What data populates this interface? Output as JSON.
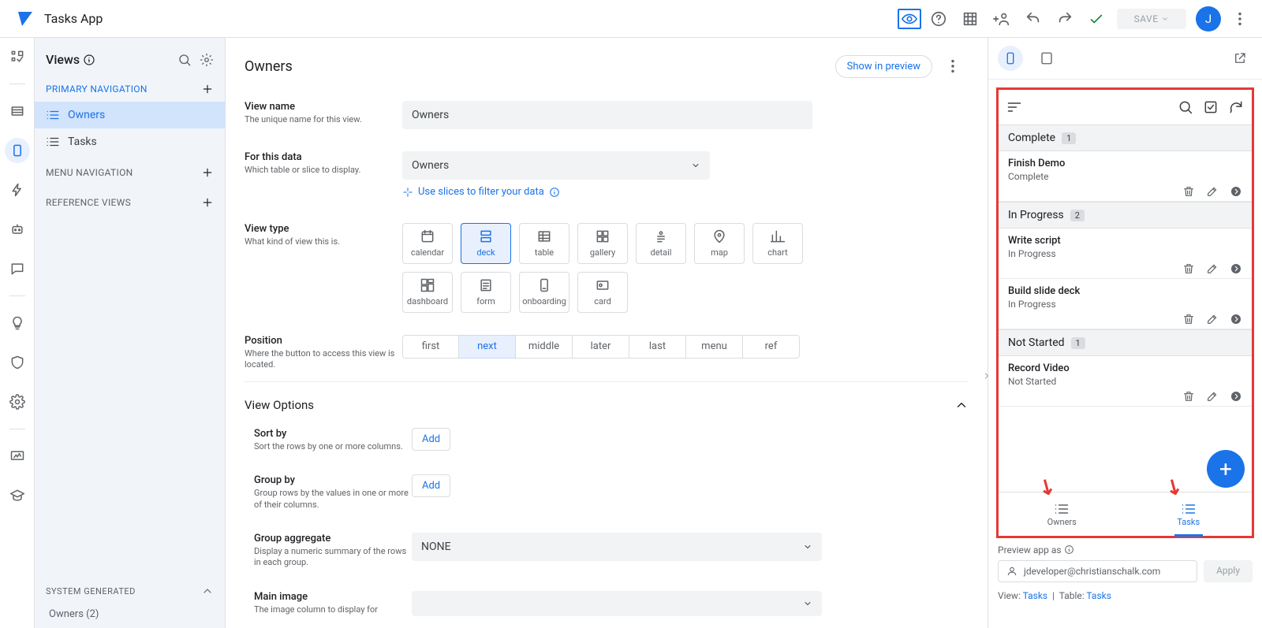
{
  "header": {
    "app_name": "Tasks App",
    "save_label": "SAVE",
    "avatar_initial": "J"
  },
  "views_panel": {
    "title": "Views",
    "sections": {
      "primary": "PRIMARY NAVIGATION",
      "menu": "MENU NAVIGATION",
      "ref": "REFERENCE VIEWS",
      "sysgen": "SYSTEM GENERATED",
      "sysgen_item": "Owners (2)"
    },
    "items": [
      "Owners",
      "Tasks"
    ]
  },
  "editor": {
    "title": "Owners",
    "show_in_preview": "Show in preview",
    "view_name": {
      "label": "View name",
      "help": "The unique name for this view.",
      "value": "Owners"
    },
    "for_data": {
      "label": "For this data",
      "help": "Which table or slice to display.",
      "value": "Owners",
      "hint": "Use slices to filter your data"
    },
    "view_type": {
      "label": "View type",
      "help": "What kind of view this is.",
      "options": [
        "calendar",
        "deck",
        "table",
        "gallery",
        "detail",
        "map",
        "chart",
        "dashboard",
        "form",
        "onboarding",
        "card"
      ],
      "selected": "deck"
    },
    "position": {
      "label": "Position",
      "help": "Where the button to access this view is located.",
      "options": [
        "first",
        "next",
        "middle",
        "later",
        "last",
        "menu",
        "ref"
      ],
      "selected": "next"
    },
    "view_options_title": "View Options",
    "sort_by": {
      "label": "Sort by",
      "help": "Sort the rows by one or more columns.",
      "btn": "Add"
    },
    "group_by": {
      "label": "Group by",
      "help": "Group rows by the values in one or more of their columns.",
      "btn": "Add"
    },
    "group_agg": {
      "label": "Group aggregate",
      "help": "Display a numeric summary of the rows in each group.",
      "value": "NONE"
    },
    "main_image": {
      "label": "Main image",
      "help": "The image column to display for"
    }
  },
  "preview": {
    "groups": [
      {
        "name": "Complete",
        "count": 1,
        "items": [
          {
            "title": "Finish Demo",
            "status": "Complete"
          }
        ]
      },
      {
        "name": "In Progress",
        "count": 2,
        "items": [
          {
            "title": "Write script",
            "status": "In Progress"
          },
          {
            "title": "Build slide deck",
            "status": "In Progress"
          }
        ]
      },
      {
        "name": "Not Started",
        "count": 1,
        "items": [
          {
            "title": "Record Video",
            "status": "Not Started"
          }
        ]
      }
    ],
    "nav": [
      "Owners",
      "Tasks"
    ],
    "footer_label": "Preview app as",
    "impersonate": "jdeveloper@christianschalk.com",
    "apply": "Apply",
    "status_view_label": "View:",
    "status_view": "Tasks",
    "status_table_label": "Table:",
    "status_table": "Tasks"
  }
}
